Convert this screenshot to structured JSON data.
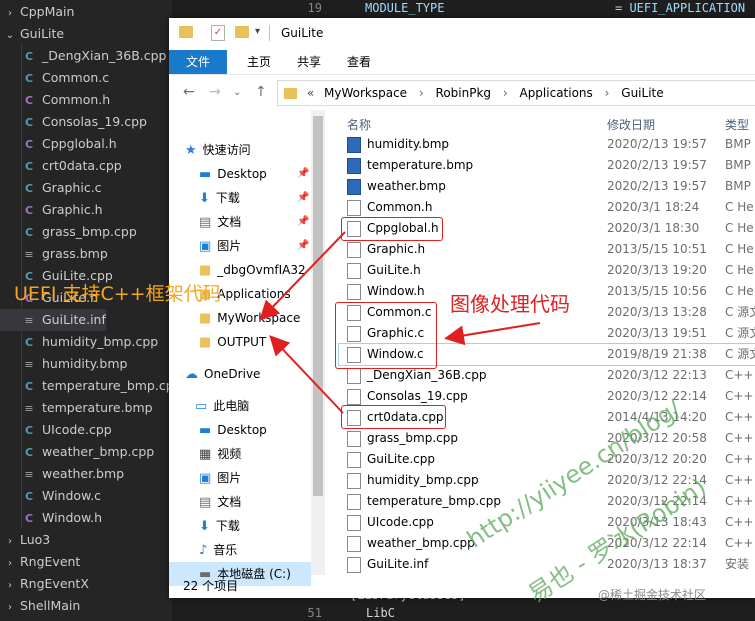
{
  "tree": {
    "items": [
      {
        "label": "CppMain",
        "kind": "folder",
        "chevron": "›"
      },
      {
        "label": "GuiLite",
        "kind": "folder",
        "chevron": "⌄"
      },
      {
        "label": "_DengXian_36B.cpp",
        "kind": "cpp",
        "icon": "C"
      },
      {
        "label": "Common.c",
        "kind": "c",
        "icon": "C"
      },
      {
        "label": "Common.h",
        "kind": "h",
        "icon": "C"
      },
      {
        "label": "Consolas_19.cpp",
        "kind": "cpp",
        "icon": "C"
      },
      {
        "label": "Cppglobal.h",
        "kind": "h",
        "icon": "C"
      },
      {
        "label": "crt0data.cpp",
        "kind": "cpp",
        "icon": "C"
      },
      {
        "label": "Graphic.c",
        "kind": "c",
        "icon": "C"
      },
      {
        "label": "Graphic.h",
        "kind": "h",
        "icon": "C"
      },
      {
        "label": "grass_bmp.cpp",
        "kind": "cpp",
        "icon": "C"
      },
      {
        "label": "grass.bmp",
        "kind": "bmp",
        "icon": "≡"
      },
      {
        "label": "GuiLite.cpp",
        "kind": "cpp",
        "icon": "C"
      },
      {
        "label": "GuiLite.h",
        "kind": "h",
        "icon": "C"
      },
      {
        "label": "GuiLite.inf",
        "kind": "inf",
        "icon": "≡"
      },
      {
        "label": "humidity_bmp.cpp",
        "kind": "cpp",
        "icon": "C"
      },
      {
        "label": "humidity.bmp",
        "kind": "bmp",
        "icon": "≡"
      },
      {
        "label": "temperature_bmp.cpp",
        "kind": "cpp",
        "icon": "C"
      },
      {
        "label": "temperature.bmp",
        "kind": "bmp",
        "icon": "≡"
      },
      {
        "label": "UIcode.cpp",
        "kind": "cpp",
        "icon": "C"
      },
      {
        "label": "weather_bmp.cpp",
        "kind": "cpp",
        "icon": "C"
      },
      {
        "label": "weather.bmp",
        "kind": "bmp",
        "icon": "≡"
      },
      {
        "label": "Window.c",
        "kind": "c",
        "icon": "C"
      },
      {
        "label": "Window.h",
        "kind": "h",
        "icon": "C"
      },
      {
        "label": "Luo3",
        "kind": "folder",
        "chevron": "›"
      },
      {
        "label": "RngEvent",
        "kind": "folder",
        "chevron": "›"
      },
      {
        "label": "RngEventX",
        "kind": "folder",
        "chevron": "›"
      },
      {
        "label": "ShellMain",
        "kind": "folder",
        "chevron": "›"
      }
    ]
  },
  "editor": {
    "line_top": "19",
    "code_top_key": "MODULE_TYPE",
    "code_top_val": "= UEFI_APPLICATION",
    "line_bottom": "51",
    "code_bottom_1": "[LibraryClasses]",
    "code_bottom_2": "LibC"
  },
  "window": {
    "title": "GuiLite",
    "ribbon_tabs": [
      "文件",
      "主页",
      "共享",
      "查看"
    ],
    "address": {
      "prefix": "«",
      "crumbs": [
        "MyWorkspace",
        "RobinPkg",
        "Applications",
        "GuiLite"
      ],
      "sep": "›"
    },
    "nav": [
      {
        "label": "快速访问",
        "icon": "★",
        "color": "#2a7fd6"
      },
      {
        "label": "Desktop",
        "icon": "▬",
        "color": "#1f7fd4",
        "pin": "📌"
      },
      {
        "label": "下载",
        "icon": "⬇",
        "color": "#1f7fd4",
        "pin": "📌"
      },
      {
        "label": "文档",
        "icon": "▤",
        "color": "#6d6d6d",
        "pin": "📌"
      },
      {
        "label": "图片",
        "icon": "▣",
        "color": "#1f7fd4",
        "pin": "📌"
      },
      {
        "label": "_dbgOvmfIA32",
        "icon": "■",
        "color": "#e8c15a"
      },
      {
        "label": "Applications",
        "icon": "■",
        "color": "#e8c15a"
      },
      {
        "label": "MyWorkspace",
        "icon": "■",
        "color": "#e8c15a"
      },
      {
        "label": "OUTPUT",
        "icon": "■",
        "color": "#e8c15a"
      },
      {
        "label": "OneDrive",
        "icon": "☁",
        "color": "#1f7fd4"
      },
      {
        "label": "此电脑",
        "icon": "▭",
        "color": "#1f7fd4"
      },
      {
        "label": "Desktop",
        "icon": "▬",
        "color": "#1f7fd4"
      },
      {
        "label": "视频",
        "icon": "▦",
        "color": "#3c3c3c"
      },
      {
        "label": "图片",
        "icon": "▣",
        "color": "#1f7fd4"
      },
      {
        "label": "文档",
        "icon": "▤",
        "color": "#6d6d6d"
      },
      {
        "label": "下载",
        "icon": "⬇",
        "color": "#1f7fd4"
      },
      {
        "label": "音乐",
        "icon": "♪",
        "color": "#1f7fd4"
      },
      {
        "label": "本地磁盘 (C:)",
        "icon": "▬",
        "color": "#6d6d6d"
      }
    ],
    "columns": {
      "name": "名称",
      "date": "修改日期",
      "type": "类型"
    },
    "files": [
      {
        "name": "humidity.bmp",
        "date": "2020/2/13 19:57",
        "type": "BMP",
        "kind": "bmp"
      },
      {
        "name": "temperature.bmp",
        "date": "2020/2/13 19:57",
        "type": "BMP",
        "kind": "bmp"
      },
      {
        "name": "weather.bmp",
        "date": "2020/2/13 19:57",
        "type": "BMP",
        "kind": "bmp"
      },
      {
        "name": "Common.h",
        "date": "2020/3/1 18:24",
        "type": "C He",
        "kind": "c"
      },
      {
        "name": "Cppglobal.h",
        "date": "2020/3/1 18:30",
        "type": "C He",
        "kind": "c"
      },
      {
        "name": "Graphic.h",
        "date": "2013/5/15 10:51",
        "type": "C He",
        "kind": "c"
      },
      {
        "name": "GuiLite.h",
        "date": "2020/3/13 19:20",
        "type": "C He",
        "kind": "c"
      },
      {
        "name": "Window.h",
        "date": "2013/5/15 10:56",
        "type": "C He",
        "kind": "c"
      },
      {
        "name": "Common.c",
        "date": "2020/3/13 13:28",
        "type": "C 源文",
        "kind": "c"
      },
      {
        "name": "Graphic.c",
        "date": "2020/3/13 19:51",
        "type": "C 源文",
        "kind": "c"
      },
      {
        "name": "Window.c",
        "date": "2019/8/19 21:38",
        "type": "C 源文",
        "kind": "c"
      },
      {
        "name": "_DengXian_36B.cpp",
        "date": "2020/3/12 22:13",
        "type": "C++",
        "kind": "c"
      },
      {
        "name": "Consolas_19.cpp",
        "date": "2020/3/12 22:14",
        "type": "C++",
        "kind": "c"
      },
      {
        "name": "crt0data.cpp",
        "date": "2014/4/13 14:20",
        "type": "C++",
        "kind": "c"
      },
      {
        "name": "grass_bmp.cpp",
        "date": "2020/3/12 20:58",
        "type": "C++",
        "kind": "c"
      },
      {
        "name": "GuiLite.cpp",
        "date": "2020/3/12 20:20",
        "type": "C++",
        "kind": "c"
      },
      {
        "name": "humidity_bmp.cpp",
        "date": "2020/3/12 22:14",
        "type": "C++",
        "kind": "c"
      },
      {
        "name": "temperature_bmp.cpp",
        "date": "2020/3/12 22:14",
        "type": "C++",
        "kind": "c"
      },
      {
        "name": "UIcode.cpp",
        "date": "2020/3/13 18:43",
        "type": "C++",
        "kind": "c"
      },
      {
        "name": "weather_bmp.cpp",
        "date": "2020/3/12 22:14",
        "type": "C++",
        "kind": "c"
      },
      {
        "name": "GuiLite.inf",
        "date": "2020/3/13 18:37",
        "type": "安装",
        "kind": "inf"
      }
    ],
    "status": "22 个项目"
  },
  "annotations": {
    "uefi_label": "UEFI 支持C++框架代码",
    "image_label": "图像处理代码",
    "watermark_url": "http://yiiyee.cn/blog/",
    "watermark_author": "易也 - 罗冰(Robin)",
    "watermark_site": "@稀土掘金技术社区",
    "accent_red": "#e02020",
    "accent_orange": "#f5a623"
  }
}
